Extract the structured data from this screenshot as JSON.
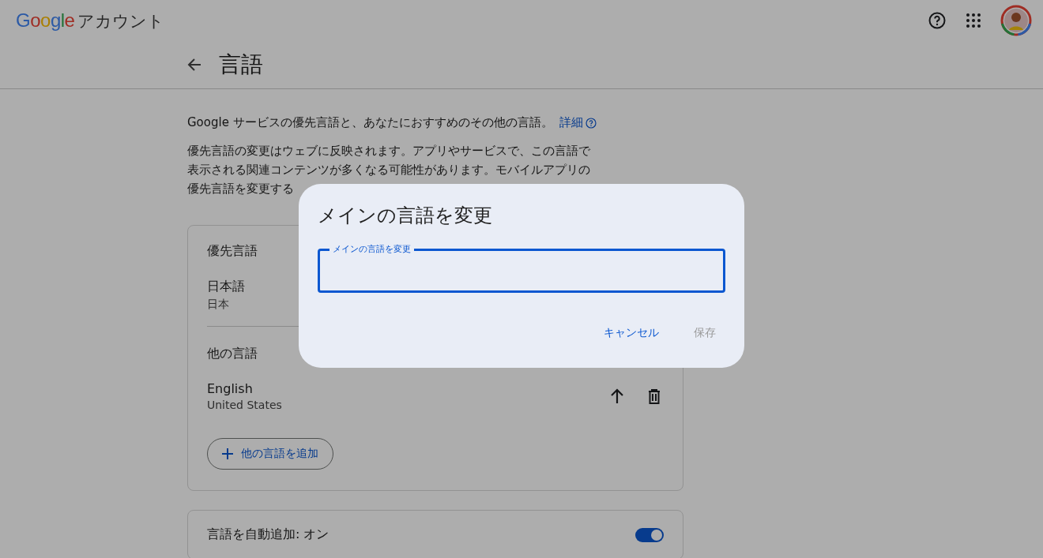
{
  "header": {
    "logo": "Google",
    "app_name": "アカウント"
  },
  "page": {
    "title": "言語"
  },
  "intro": {
    "text": "Google サービスの優先言語と、あなたにおすすめのその他の言語。",
    "link": "詳細"
  },
  "description": [
    "優先言語の変更はウェブに反映されます。アプリやサービスで、この言語で",
    "表示される関連コンテンツが多くなる可能性があります。モバイルアプリの",
    "優先言語を変更する"
  ],
  "preferred": {
    "heading": "優先言語",
    "language": "日本語",
    "region": "日本"
  },
  "other": {
    "heading": "他の言語",
    "languages": [
      {
        "language": "English",
        "region": "United States"
      }
    ],
    "add_button": "他の言語を追加"
  },
  "auto_add": {
    "label": "言語を自動追加: オン",
    "on": true
  },
  "dialog": {
    "title": "メインの言語を変更",
    "field_label": "メインの言語を変更",
    "cancel": "キャンセル",
    "save": "保存",
    "save_disabled": true
  }
}
